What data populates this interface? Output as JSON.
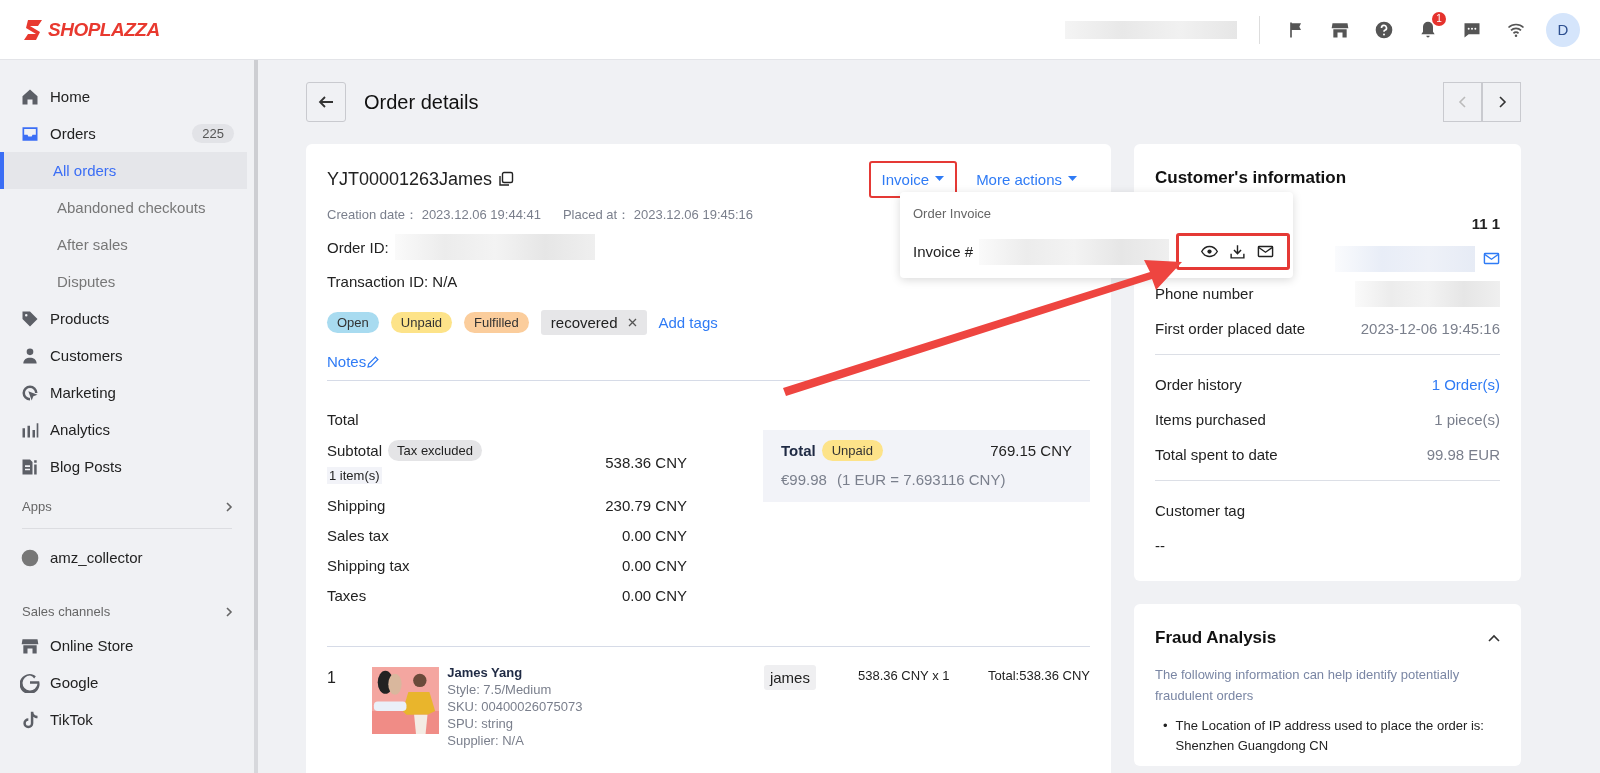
{
  "header": {
    "logo": "SHOPLAZZA",
    "notification_count": "1",
    "avatar": "D"
  },
  "sidebar": {
    "sections": [
      {
        "items": [
          {
            "label": "Home",
            "selected": false
          },
          {
            "label": "Orders",
            "count": "225",
            "selected": false,
            "expanded": true,
            "children": [
              {
                "label": "All orders",
                "selected": true
              },
              {
                "label": "Abandoned checkouts",
                "selected": false
              },
              {
                "label": "After sales",
                "selected": false
              },
              {
                "label": "Disputes",
                "selected": false
              }
            ]
          },
          {
            "label": "Products",
            "selected": false
          },
          {
            "label": "Customers",
            "selected": false
          },
          {
            "label": "Marketing",
            "selected": false
          },
          {
            "label": "Analytics",
            "selected": false
          },
          {
            "label": "Blog Posts",
            "selected": false
          }
        ]
      },
      {
        "title": "Apps",
        "items": [
          {
            "label": "amz_collector",
            "selected": false
          }
        ]
      },
      {
        "title": "Sales channels",
        "items": [
          {
            "label": "Online Store",
            "selected": false
          },
          {
            "label": "Google",
            "selected": false
          },
          {
            "label": "TikTok",
            "selected": false
          }
        ]
      }
    ]
  },
  "page": {
    "title": "Order details"
  },
  "order": {
    "number": "YJT00001263James",
    "actions": [
      {
        "label": "Invoice",
        "highlighted": true
      },
      {
        "label": "More actions",
        "highlighted": false
      }
    ],
    "creation_label": "Creation date：",
    "creation_date": "2023.12.06 19:44:41",
    "placed_label": "Placed at：",
    "placed_date": "2023.12.06 19:45:16",
    "order_id_label": "Order ID:",
    "transaction": "Transaction ID: N/A",
    "statuses": [
      {
        "label": "Open",
        "color": "#a8dbf0"
      },
      {
        "label": "Unpaid",
        "color": "#fde389"
      },
      {
        "label": "Fulfilled",
        "color": "#fbcd9c"
      }
    ],
    "tags": [
      {
        "label": "recovered",
        "removable": true
      }
    ],
    "add_tags": "Add tags",
    "notes": "Notes",
    "totals": {
      "heading": "Total",
      "rows": [
        {
          "label": "Subtotal",
          "badge": "Tax excluded",
          "note": "1 item(s)",
          "value": "538.36 CNY"
        },
        {
          "label": "Shipping",
          "value": "230.79 CNY"
        },
        {
          "label": "Sales tax",
          "value": "0.00 CNY"
        },
        {
          "label": "Shipping tax",
          "value": "0.00 CNY"
        },
        {
          "label": "Taxes",
          "value": "0.00 CNY"
        }
      ],
      "summary": {
        "label": "Total",
        "badge": "Unpaid",
        "amount": "769.15 CNY",
        "converted": "€99.98",
        "rate": "(1 EUR = 7.693116 CNY)"
      }
    },
    "line_items": [
      {
        "index": "1",
        "image": {
          "kind": "picture"
        },
        "name": "James Yang",
        "details": [
          "Style: 7.5/Medium",
          "SKU: 00400026075073",
          "SPU: string",
          "Supplier: N/A"
        ],
        "tag": "james",
        "price": "538.36 CNY x 1",
        "total": "Total:538.36 CNY"
      }
    ]
  },
  "invoice_menu": {
    "open": true,
    "title": "Order Invoice",
    "item_label": "Invoice #",
    "icons_highlighted": true
  },
  "annotation_arrow": true,
  "customer": {
    "title": "Customer's information",
    "name_value": "11 1",
    "phone_label": "Phone number",
    "first_order_label": "First order placed date",
    "first_order_date": "2023-12-06 19:45:16",
    "stats": [
      {
        "label": "Order history",
        "value": "1 Order(s)",
        "link": true
      },
      {
        "label": "Items purchased",
        "value": "1 piece(s)",
        "link": false
      },
      {
        "label": "Total spent to date",
        "value": "99.98 EUR",
        "link": false
      }
    ],
    "tag_label": "Customer tag",
    "tag_value": "--"
  },
  "fraud": {
    "title": "Fraud Analysis",
    "expanded": true,
    "description": "The following information can help identify potentially fraudulent orders",
    "bullets": [
      {
        "marker": "•",
        "text": "The Location of IP address used to place the order is: Shenzhen Guangdong CN"
      }
    ]
  }
}
